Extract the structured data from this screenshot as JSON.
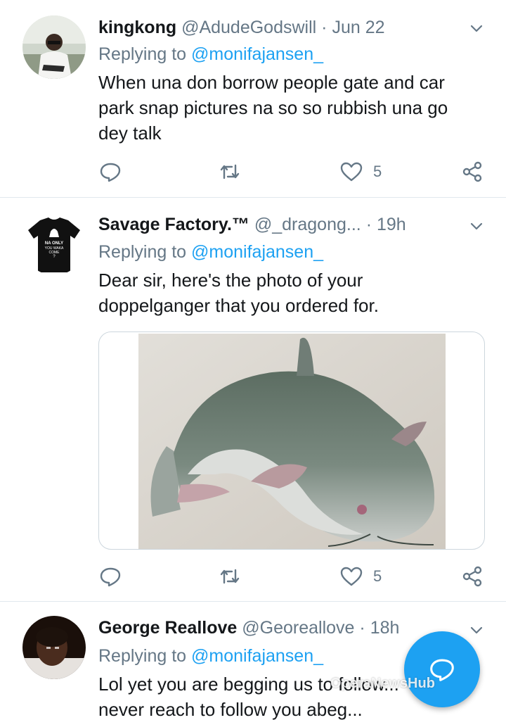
{
  "tweets": [
    {
      "name": "kingkong",
      "handle": "@AdudeGodswill",
      "separator": "·",
      "time": "Jun 22",
      "replying_prefix": "Replying to",
      "replying_mention": "@monifajansen_",
      "text_lines": [
        "When una don borrow people gate and car",
        "park snap pictures na so so rubbish una go",
        "dey talk"
      ],
      "like_count": "5"
    },
    {
      "name": "Savage Factory.™",
      "handle": "@_dragong...",
      "separator": "·",
      "time": "19h",
      "replying_prefix": "Replying to",
      "replying_mention": "@monifajansen_",
      "text_lines": [
        "Dear sir, here's the photo of your",
        "doppelganger that you ordered for."
      ],
      "avatar_shirt_text": [
        "NA ONLY",
        "YOU WAKA",
        "COME",
        "?"
      ],
      "like_count": "5"
    },
    {
      "name": "George Reallove",
      "handle": "@Georeallove",
      "separator": "·",
      "time": "18h",
      "replying_prefix": "Replying to",
      "replying_mention": "@monifajansen_",
      "text_lines": [
        "Lol yet you are begging us to follow...",
        "never reach to follow you abeg..."
      ]
    }
  ],
  "icons": {
    "reply": "reply-icon",
    "retweet": "retweet-icon",
    "like": "heart-icon",
    "share": "share-icon",
    "caret": "chevron-down-icon",
    "compose": "compose-reply-icon"
  },
  "watermark": "OperaNewsHub",
  "colors": {
    "accent": "#1da1f2",
    "text": "#14171a",
    "secondary": "#657786",
    "divider": "#e1e8ed"
  }
}
